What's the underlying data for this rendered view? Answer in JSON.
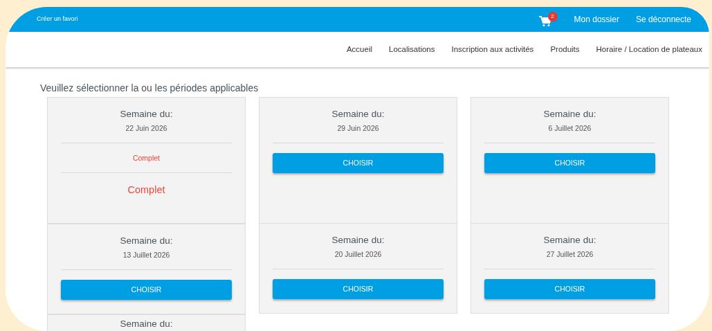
{
  "top_bar": {
    "left_link": "Créer un favori",
    "cart_count": "2",
    "links": [
      "Mon dossier",
      "Se déconnecte"
    ]
  },
  "nav": {
    "items": [
      {
        "label": "Accueil",
        "selected": false
      },
      {
        "label": "Localisations",
        "selected": false
      },
      {
        "label": "Inscription aux activités",
        "selected": false
      },
      {
        "label": "Produits",
        "selected": false
      },
      {
        "label": "Horaire / Location de plateaux",
        "selected": false
      }
    ]
  },
  "heading": "Veuillez sélectionner la ou les périodes applicables",
  "weeks": [
    {
      "kind": "full",
      "title": "Semaine du:",
      "date": "22 Juin 2026",
      "status": "Complet",
      "status_large": "Complet"
    },
    {
      "kind": "available",
      "title": "Semaine du:",
      "date": "29 Juin 2026",
      "button": "CHOISIR"
    },
    {
      "kind": "available",
      "title": "Semaine du:",
      "date": "6 Juillet 2026",
      "button": "CHOISIR"
    },
    {
      "kind": "available",
      "title": "Semaine du:",
      "date": "13 Juillet 2026",
      "button": "CHOISIR"
    },
    {
      "kind": "available",
      "title": "Semaine du:",
      "date": "20 Juillet 2026",
      "button": "CHOISIR"
    },
    {
      "kind": "available",
      "title": "Semaine du:",
      "date": "27 Juillet 2026",
      "button": "CHOISIR"
    },
    {
      "kind": "partial",
      "title": "Semaine du:"
    }
  ]
}
